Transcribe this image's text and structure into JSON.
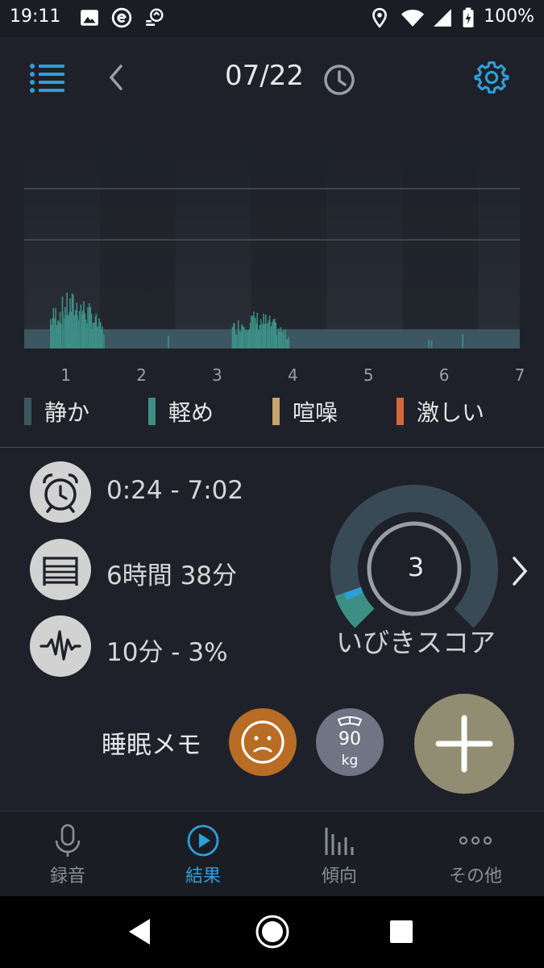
{
  "status_bar": {
    "time": "19:11",
    "battery_percent": "100%",
    "icons": [
      "image-icon",
      "e-app-icon",
      "sync-icon",
      "location-icon",
      "wifi-icon",
      "signal-icon",
      "battery-icon"
    ]
  },
  "header": {
    "date": "07/22",
    "menu_icon": "menu-list-icon",
    "back_icon": "chevron-left-icon",
    "history_icon": "clock-icon",
    "settings_icon": "gear-icon"
  },
  "colors": {
    "background": "#1e2129",
    "accent": "#2e9fd9",
    "quiet": "#3c5761",
    "light": "#3d8f86",
    "noisy": "#c8a36a",
    "loud": "#d4673c",
    "mood": "#b86c24",
    "weight_bubble": "#6f7585",
    "add_button": "#918d72"
  },
  "chart_data": {
    "type": "bar",
    "x_ticks": [
      "1",
      "2",
      "3",
      "4",
      "5",
      "6",
      "7"
    ],
    "legend": [
      {
        "label": "静か",
        "color": "#3c5761"
      },
      {
        "label": "軽め",
        "color": "#3d8f86"
      },
      {
        "label": "喧噪",
        "color": "#c8a36a"
      },
      {
        "label": "激しい",
        "color": "#d4673c"
      }
    ],
    "xlim": [
      0.45,
      7
    ],
    "ylim": [
      0,
      1
    ],
    "baseline_level": 0.12,
    "grid_levels": [
      0.68,
      1
    ],
    "hour_band_starts": [
      0.45,
      1.45,
      2.45,
      3.45,
      4.45,
      5.45,
      6.45
    ],
    "bursts": [
      {
        "start": 0.8,
        "end": 1.5,
        "peak": 0.36,
        "density": 52
      },
      {
        "start": 2.35,
        "end": 2.37,
        "peak": 0.15,
        "density": 1
      },
      {
        "start": 3.2,
        "end": 3.95,
        "peak": 0.24,
        "density": 48
      },
      {
        "start": 5.8,
        "end": 5.83,
        "peak": 0.17,
        "density": 2
      },
      {
        "start": 6.24,
        "end": 6.26,
        "peak": 0.14,
        "density": 1
      }
    ]
  },
  "stats": {
    "time_range": "0:24 - 7:02",
    "duration": "6時間 38分",
    "snore": "10分 - 3%"
  },
  "gauge": {
    "score": "3",
    "label": "いびきスコア",
    "score_value": 3,
    "score_max": 100
  },
  "memo": {
    "label": "睡眠メモ",
    "weight_value": "90",
    "weight_unit": "kg"
  },
  "bottom_nav": {
    "tabs": [
      {
        "label": "録音",
        "icon": "microphone-icon",
        "active": false
      },
      {
        "label": "結果",
        "icon": "play-circle-icon",
        "active": true
      },
      {
        "label": "傾向",
        "icon": "bar-chart-icon",
        "active": false
      },
      {
        "label": "その他",
        "icon": "more-dots-icon",
        "active": false
      }
    ]
  }
}
